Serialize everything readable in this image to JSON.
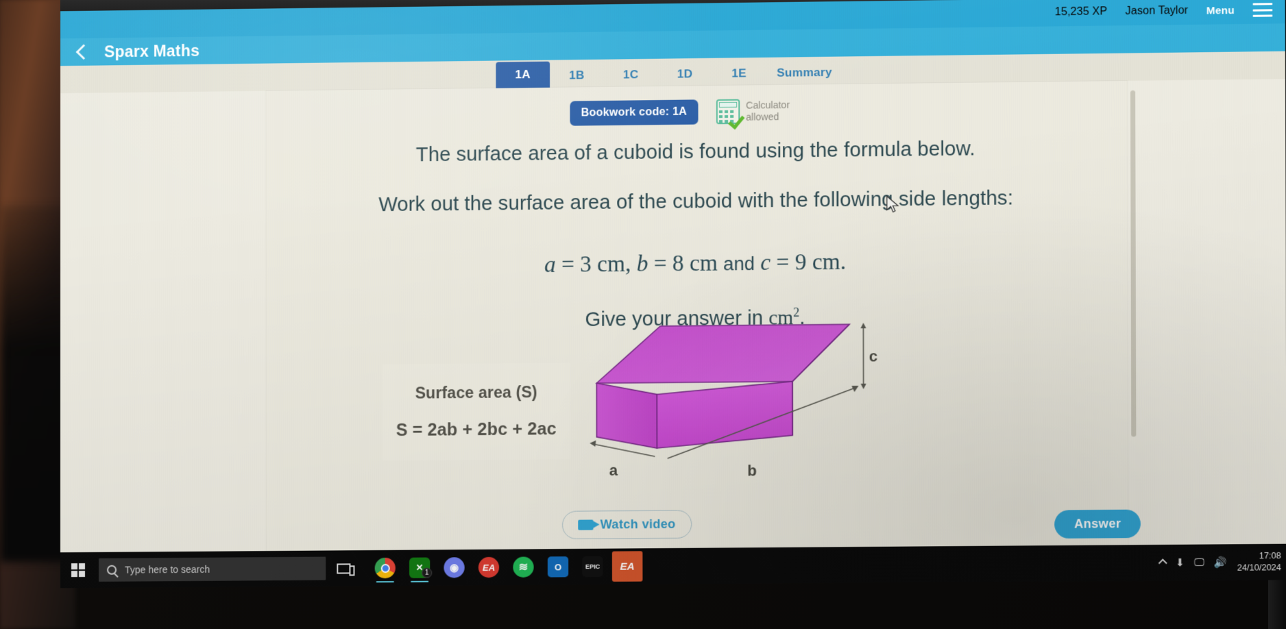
{
  "app": {
    "topbar": {
      "xp": "15,235 XP",
      "user_name": "Jason Taylor",
      "menu_label": "Menu"
    },
    "header": {
      "brand": "Sparx Maths"
    },
    "tabs": [
      {
        "label": "1A",
        "active": true
      },
      {
        "label": "1B",
        "active": false
      },
      {
        "label": "1C",
        "active": false
      },
      {
        "label": "1D",
        "active": false
      },
      {
        "label": "1E",
        "active": false
      },
      {
        "label": "Summary",
        "active": false
      }
    ],
    "badges": {
      "bookwork_code": "Bookwork code: 1A",
      "calculator_line1": "Calculator",
      "calculator_line2": "allowed"
    },
    "question": {
      "line1": "The surface area of a cuboid is found using the formula below.",
      "line2": "Work out the surface area of the cuboid with the following side lengths:",
      "math_a_var": "a",
      "math_a_eq": "=",
      "math_a_val": "3",
      "math_a_unit": "cm,",
      "math_b_var": "b",
      "math_b_eq": "=",
      "math_b_val": "8",
      "math_b_unit": "cm",
      "math_conj": "and",
      "math_c_var": "c",
      "math_c_eq": "=",
      "math_c_val": "9",
      "math_c_unit": "cm.",
      "line3_prefix": "Give your answer in ",
      "line3_unit": "cm",
      "line3_exponent": "2",
      "line3_suffix": "."
    },
    "formula_panel": {
      "title": "Surface area (S)",
      "equation": "S = 2ab + 2bc + 2ac"
    },
    "diagram": {
      "label_a": "a",
      "label_b": "b",
      "label_c": "c",
      "shape_color": "#d24fd8",
      "shape_color_top": "#cc5cd4",
      "shape_color_front": "#d65ae0",
      "shape_outline": "#7b2a8c"
    },
    "buttons": {
      "watch_video": "Watch video",
      "answer": "Answer"
    },
    "colors": {
      "brand_blue": "#23a8d8",
      "header_blue": "#2fb0dc",
      "tab_active_blue": "#2a5faa",
      "paper": "#eceadf"
    }
  },
  "taskbar": {
    "search_placeholder": "Type here to search",
    "apps": [
      {
        "name": "chrome",
        "label": "",
        "color": "#f4b400"
      },
      {
        "name": "xbox",
        "label": "",
        "color": "#107c10",
        "badge": "1"
      },
      {
        "name": "discord",
        "label": "",
        "color": "#5865f2"
      },
      {
        "name": "ea-app",
        "label": "EA",
        "color": "#e03a2f"
      },
      {
        "name": "spotify",
        "label": "",
        "color": "#1db954"
      },
      {
        "name": "outlook",
        "label": "O",
        "color": "#0f6cbd"
      },
      {
        "name": "epic-games",
        "label": "EPIC",
        "color": "#0f0f0f"
      },
      {
        "name": "ea-desktop",
        "label": "EA",
        "color": "#d8552a"
      }
    ],
    "clock_time": "17:08",
    "clock_date": "24/10/2024"
  }
}
